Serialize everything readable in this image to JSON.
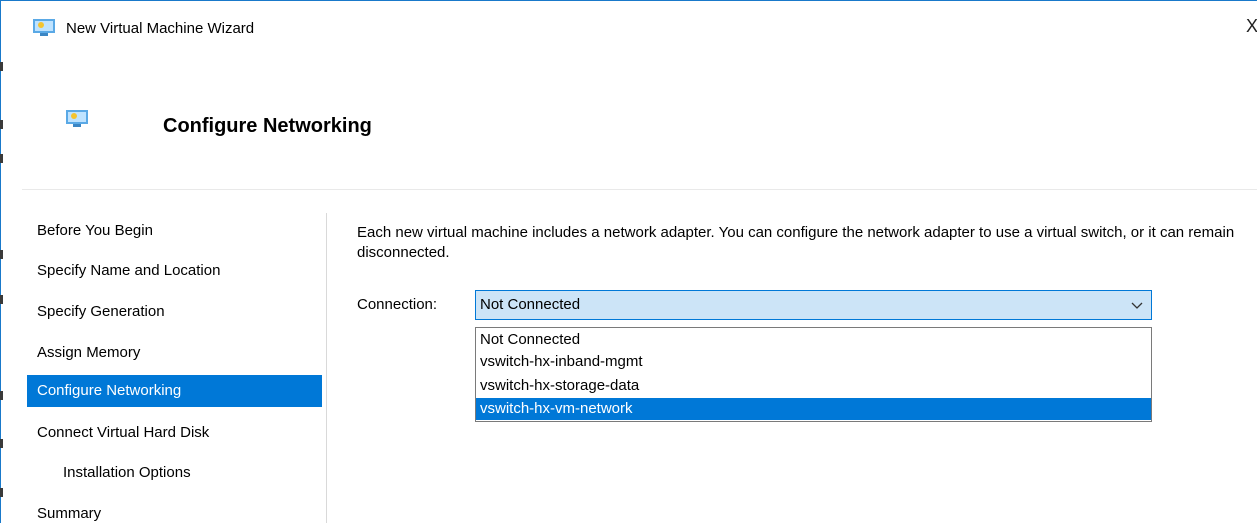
{
  "window": {
    "title": "New Virtual Machine Wizard",
    "close_label": "X",
    "app_icon": "computer-monitor-icon"
  },
  "header": {
    "icon": "computer-monitor-icon",
    "title": "Configure Networking"
  },
  "sidebar": {
    "items": [
      {
        "label": "Before You Begin",
        "active": false
      },
      {
        "label": "Specify Name and Location",
        "active": false
      },
      {
        "label": "Specify Generation",
        "active": false
      },
      {
        "label": "Assign Memory",
        "active": false
      },
      {
        "label": "Configure Networking",
        "active": true
      },
      {
        "label": "Connect Virtual Hard Disk",
        "active": false
      },
      {
        "label": "Installation Options",
        "active": false
      },
      {
        "label": "Summary",
        "active": false
      }
    ]
  },
  "main": {
    "description": "Each new virtual machine includes a network adapter. You can configure the network adapter to use a virtual switch, or it can remain disconnected.",
    "connection": {
      "label": "Connection:",
      "value": "Not Connected",
      "options": [
        "Not Connected",
        "vswitch-hx-inband-mgmt",
        "vswitch-hx-storage-data",
        "vswitch-hx-vm-network"
      ],
      "highlighted_option": "vswitch-hx-vm-network"
    }
  },
  "colors": {
    "accent": "#0078d7",
    "combo_bg": "#cce4f7",
    "window_border": "#1979ca"
  }
}
